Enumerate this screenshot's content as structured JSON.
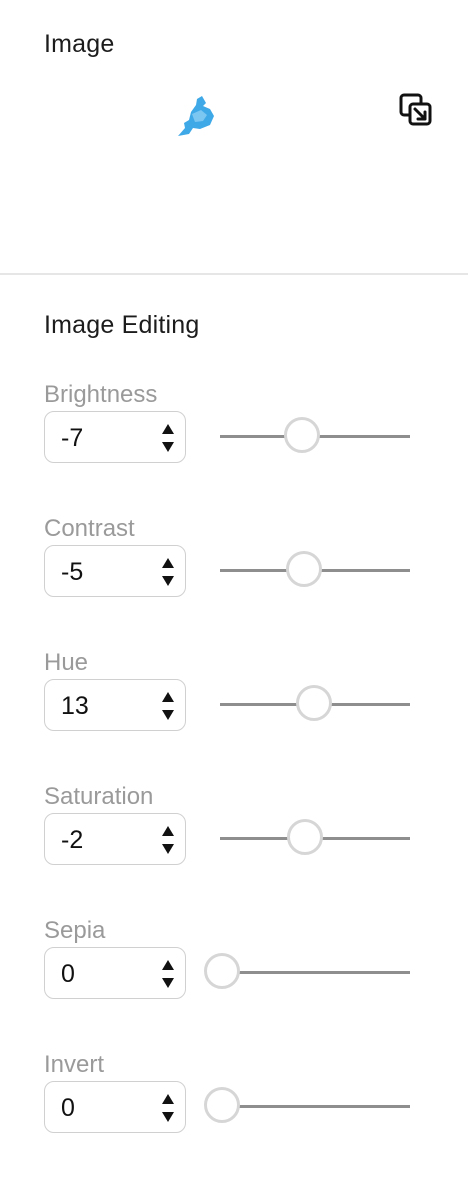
{
  "image_panel": {
    "title": "Image",
    "thumbnail_icon": "bird-icon",
    "replace_icon": "replace-image-icon",
    "accent_color": "#3fa9e8"
  },
  "editing_panel": {
    "title": "Image Editing",
    "controls": [
      {
        "label": "Brightness",
        "value": "-7",
        "slider_fraction": 0.47
      },
      {
        "label": "Contrast",
        "value": "-5",
        "slider_fraction": 0.48
      },
      {
        "label": "Hue",
        "value": "13",
        "slider_fraction": 0.54
      },
      {
        "label": "Saturation",
        "value": "-2",
        "slider_fraction": 0.49
      },
      {
        "label": "Sepia",
        "value": "0",
        "slider_fraction": 0.0
      },
      {
        "label": "Invert",
        "value": "0",
        "slider_fraction": 0.0
      }
    ]
  }
}
